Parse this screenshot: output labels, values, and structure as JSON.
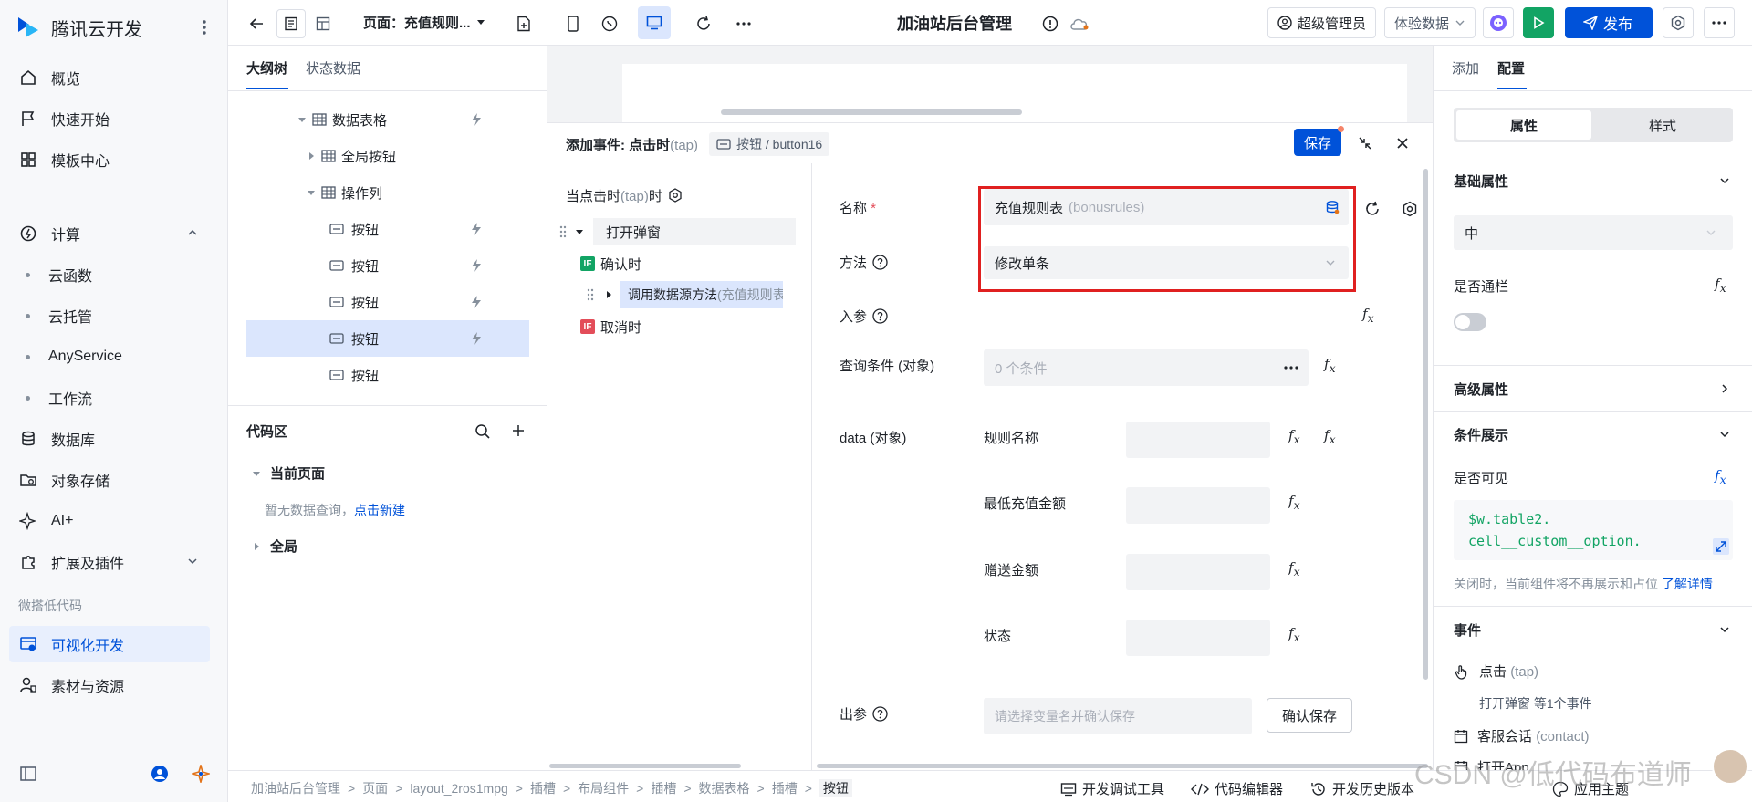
{
  "brand": {
    "name": "腾讯云开发"
  },
  "nav": {
    "items": [
      {
        "label": "概览"
      },
      {
        "label": "快速开始"
      },
      {
        "label": "模板中心"
      },
      {
        "label": "计算"
      },
      {
        "label": "云函数"
      },
      {
        "label": "云托管"
      },
      {
        "label": "AnyService"
      },
      {
        "label": "工作流"
      },
      {
        "label": "数据库"
      },
      {
        "label": "对象存储"
      },
      {
        "label": "AI+"
      },
      {
        "label": "扩展及插件"
      },
      {
        "label": "可视化开发"
      },
      {
        "label": "素材与资源"
      }
    ],
    "section_label": "微搭低代码"
  },
  "topbar": {
    "page_label": "页面：充值规则...",
    "app_title": "加油站后台管理",
    "admin_label": "超级管理员",
    "data_env": "体验数据",
    "publish_label": "发布"
  },
  "outline": {
    "tabs": [
      "大纲树",
      "状态数据"
    ],
    "rows": [
      {
        "label": "数据表格"
      },
      {
        "label": "全局按钮"
      },
      {
        "label": "操作列"
      },
      {
        "label": "按钮"
      },
      {
        "label": "按钮"
      },
      {
        "label": "按钮"
      },
      {
        "label": "按钮"
      },
      {
        "label": "按钮"
      }
    ]
  },
  "codearea": {
    "title": "代码区",
    "current_page": "当前页面",
    "empty_text": "暂无数据查询，",
    "create_link": "点击新建",
    "global": "全局"
  },
  "dialog": {
    "title": "添加事件: 点击时",
    "title_tap": "(tap)",
    "component_tag": "按钮 / button16",
    "save_label": "保存",
    "trigger": "当点击时",
    "trigger_tap": "(tap)",
    "trigger_suffix": "时",
    "action_open": "打开弹窗",
    "on_confirm": "确认时",
    "call_method": "调用数据源方法",
    "call_method_target": "(充值规则表)",
    "on_cancel": "取消时",
    "if_badge": "IF",
    "form": {
      "name_label": "名称",
      "name_value": "充值规则表",
      "name_value_code": "(bonusrules)",
      "method_label": "方法",
      "method_value": "修改单条",
      "params_label": "入参",
      "query_label": "查询条件 (对象)",
      "query_placeholder": "0 个条件",
      "data_label": "data (对象)",
      "data_fields": [
        "规则名称",
        "最低充值金额",
        "赠送金额",
        "状态"
      ],
      "out_label": "出参",
      "out_placeholder": "请选择变量名并确认保存",
      "confirm_save": "确认保存"
    }
  },
  "rightpanel": {
    "tabs": [
      "添加",
      "配置"
    ],
    "seg": [
      "属性",
      "样式"
    ],
    "basic_attrs": "基础属性",
    "size_value": "中",
    "block_label": "是否通栏",
    "advanced": "高级属性",
    "condition": "条件展示",
    "visible_label": "是否可见",
    "visible_code_1": "$w.table2.",
    "visible_code_2": "cell__custom__option.",
    "hint": "关闭时，当前组件将不再展示和占位",
    "hint_link": "了解详情",
    "events": "事件",
    "event_tap": "点击",
    "event_tap_code": "(tap)",
    "event_tap_desc": "打开弹窗 等1个事件",
    "event_contact": "客服会话",
    "event_contact_code": "(contact)",
    "event_app": "打开App",
    "theme_btn": "应用主题"
  },
  "statusbar": {
    "crumbs": [
      "加油站后台管理",
      "页面",
      "layout_2ros1mpg",
      "插槽",
      "布局组件",
      "插槽",
      "数据表格",
      "插槽",
      "按钮"
    ],
    "tools": [
      "开发调试工具",
      "代码编辑器",
      "开发历史版本"
    ]
  },
  "watermark": "CSDN @低代码布道师",
  "colors": {
    "primary": "#0052d9",
    "green": "#12a464",
    "red_highlight": "#e02020"
  }
}
